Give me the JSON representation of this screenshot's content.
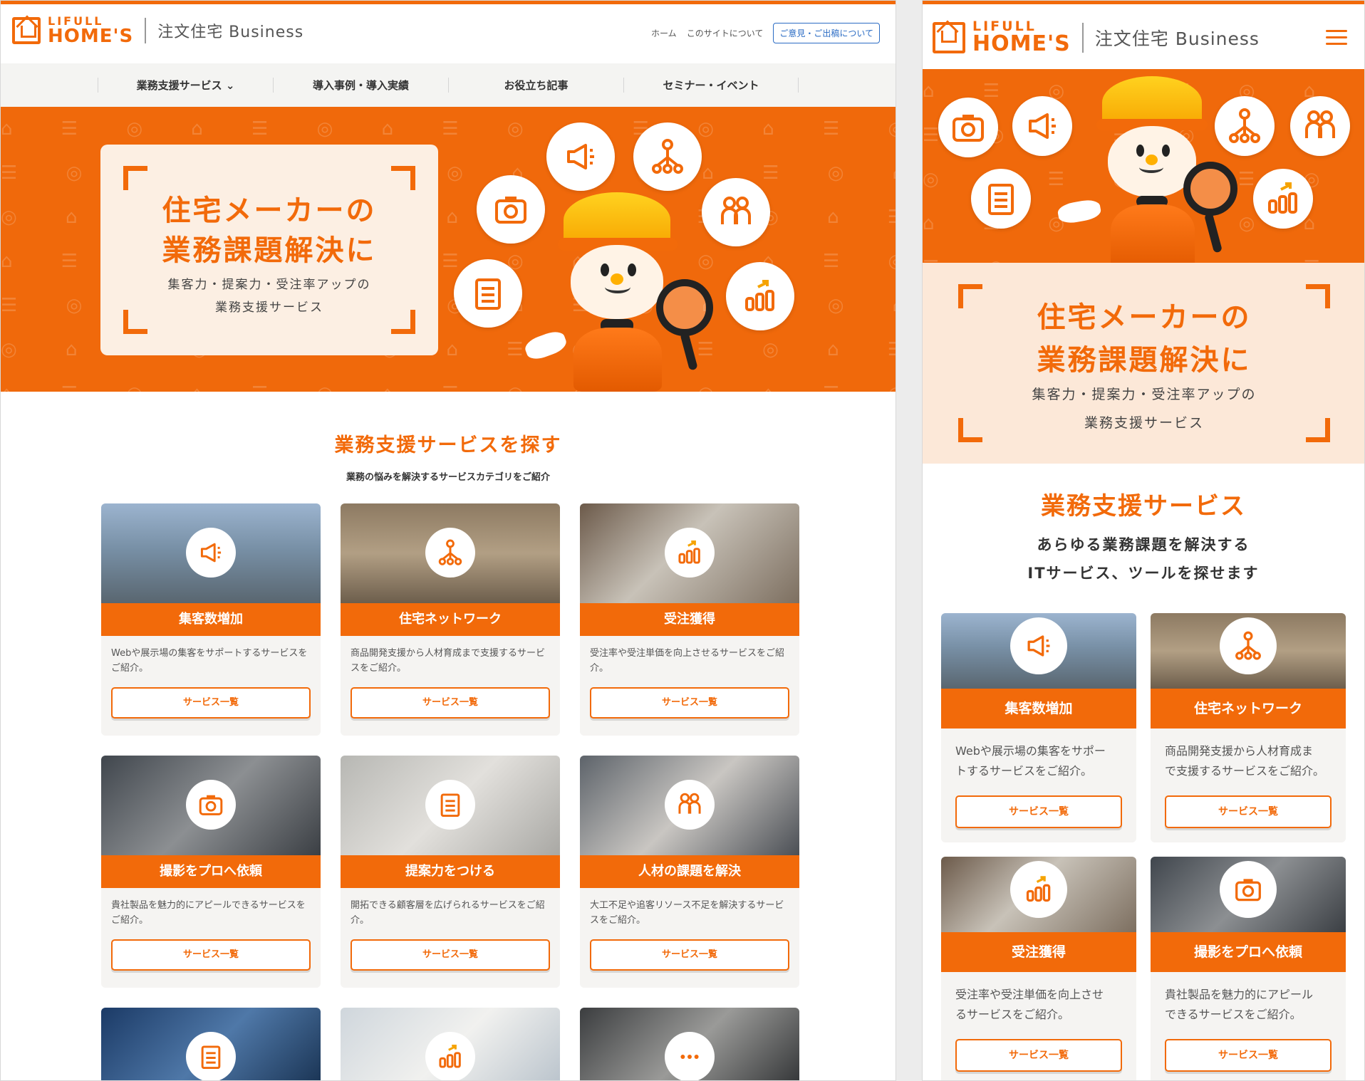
{
  "brand": {
    "logo_line1": "LIFULL",
    "logo_line2": "HOME'S",
    "site_name": "注文住宅 Business"
  },
  "header_links": {
    "home": "ホーム",
    "about": "このサイトについて",
    "feedback": "ご意見・ご出稿について"
  },
  "nav": [
    {
      "label": "業務支援サービス ⌄"
    },
    {
      "label": "導入事例・導入実績"
    },
    {
      "label": "お役立ち記事"
    },
    {
      "label": "セミナー・イベント"
    }
  ],
  "hero": {
    "title_line1": "住宅メーカーの",
    "title_line2": "業務課題解決に",
    "sub_line1": "集客力・提案力・受注率アップの",
    "sub_line2": "業務支援サービス"
  },
  "desktop_section": {
    "title": "業務支援サービスを探す",
    "subtitle": "業務の悩みを解決するサービスカテゴリをご紹介"
  },
  "mobile_section": {
    "title": "業務支援サービス",
    "subtitle_line1": "あらゆる業務課題を解決する",
    "subtitle_line2": "ITサービス、ツールを探せます"
  },
  "cards": [
    {
      "icon": "megaphone-icon",
      "title": "集客数増加",
      "desc": "Webや展示場の集客をサポートするサービスをご紹介。",
      "m_desc1": "Webや展示場の集客をサポー",
      "m_desc2": "トするサービスをご紹介。",
      "button": "サービス一覧"
    },
    {
      "icon": "network-icon",
      "title": "住宅ネットワーク",
      "desc": "商品開発支援から人材育成まで支援するサービスをご紹介。",
      "m_desc1": "商品開発支援から人材育成ま",
      "m_desc2": "で支援するサービスをご紹介。",
      "button": "サービス一覧"
    },
    {
      "icon": "growth-chart-icon",
      "title": "受注獲得",
      "desc": "受注率や受注単価を向上させるサービスをご紹介。",
      "m_desc1": "受注率や受注単価を向上させ",
      "m_desc2": "るサービスをご紹介。",
      "button": "サービス一覧"
    },
    {
      "icon": "camera-icon",
      "title": "撮影をプロへ依頼",
      "desc": "貴社製品を魅力的にアピールできるサービスをご紹介。",
      "m_desc1": "貴社製品を魅力的にアピール",
      "m_desc2": "できるサービスをご紹介。",
      "button": "サービス一覧"
    },
    {
      "icon": "clipboard-icon",
      "title": "提案力をつける",
      "desc": "開拓できる顧客層を広げられるサービスをご紹介。",
      "button": "サービス一覧"
    },
    {
      "icon": "people-icon",
      "title": "人材の課題を解決",
      "desc": "大工不足や追客リソース不足を解決するサービスをご紹介。",
      "button": "サービス一覧"
    },
    {
      "icon": "clipboard-icon"
    },
    {
      "icon": "growth-chart-icon"
    },
    {
      "icon": "more-icon"
    }
  ],
  "colors": {
    "accent": "#f26a0a",
    "hero_bg": "#f0690b",
    "card_bg": "#f5f4f2",
    "link_blue": "#2b6cc4"
  }
}
